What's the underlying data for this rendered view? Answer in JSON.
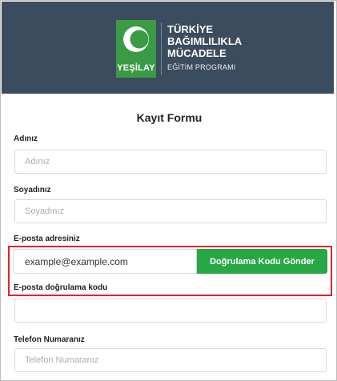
{
  "brand": {
    "logo_word": "YEŞİLAY",
    "title_lines": [
      "TÜRKİYE",
      "BAĞIMLILIKLA",
      "MÜCADELE"
    ],
    "subtitle": "EĞİTİM PROGRAMI",
    "color": "#3a9a45"
  },
  "form": {
    "title": "Kayıt Formu",
    "first_name": {
      "label": "Adınız",
      "placeholder": "Adınız",
      "value": ""
    },
    "last_name": {
      "label": "Soyadınız",
      "placeholder": "Soyadınız",
      "value": ""
    },
    "email": {
      "label": "E-posta adresiniz",
      "value": "example@example.com"
    },
    "send_code_button": "Doğrulama Kodu Gönder",
    "verification": {
      "label": "E-posta doğrulama kodu",
      "placeholder": "",
      "value": ""
    },
    "phone": {
      "label": "Telefon Numaranız",
      "placeholder": "Telefon Numaranız",
      "value": ""
    }
  },
  "colors": {
    "header_bg": "#3b4c5e",
    "button_bg": "#28a745",
    "highlight": "#e2232a"
  }
}
